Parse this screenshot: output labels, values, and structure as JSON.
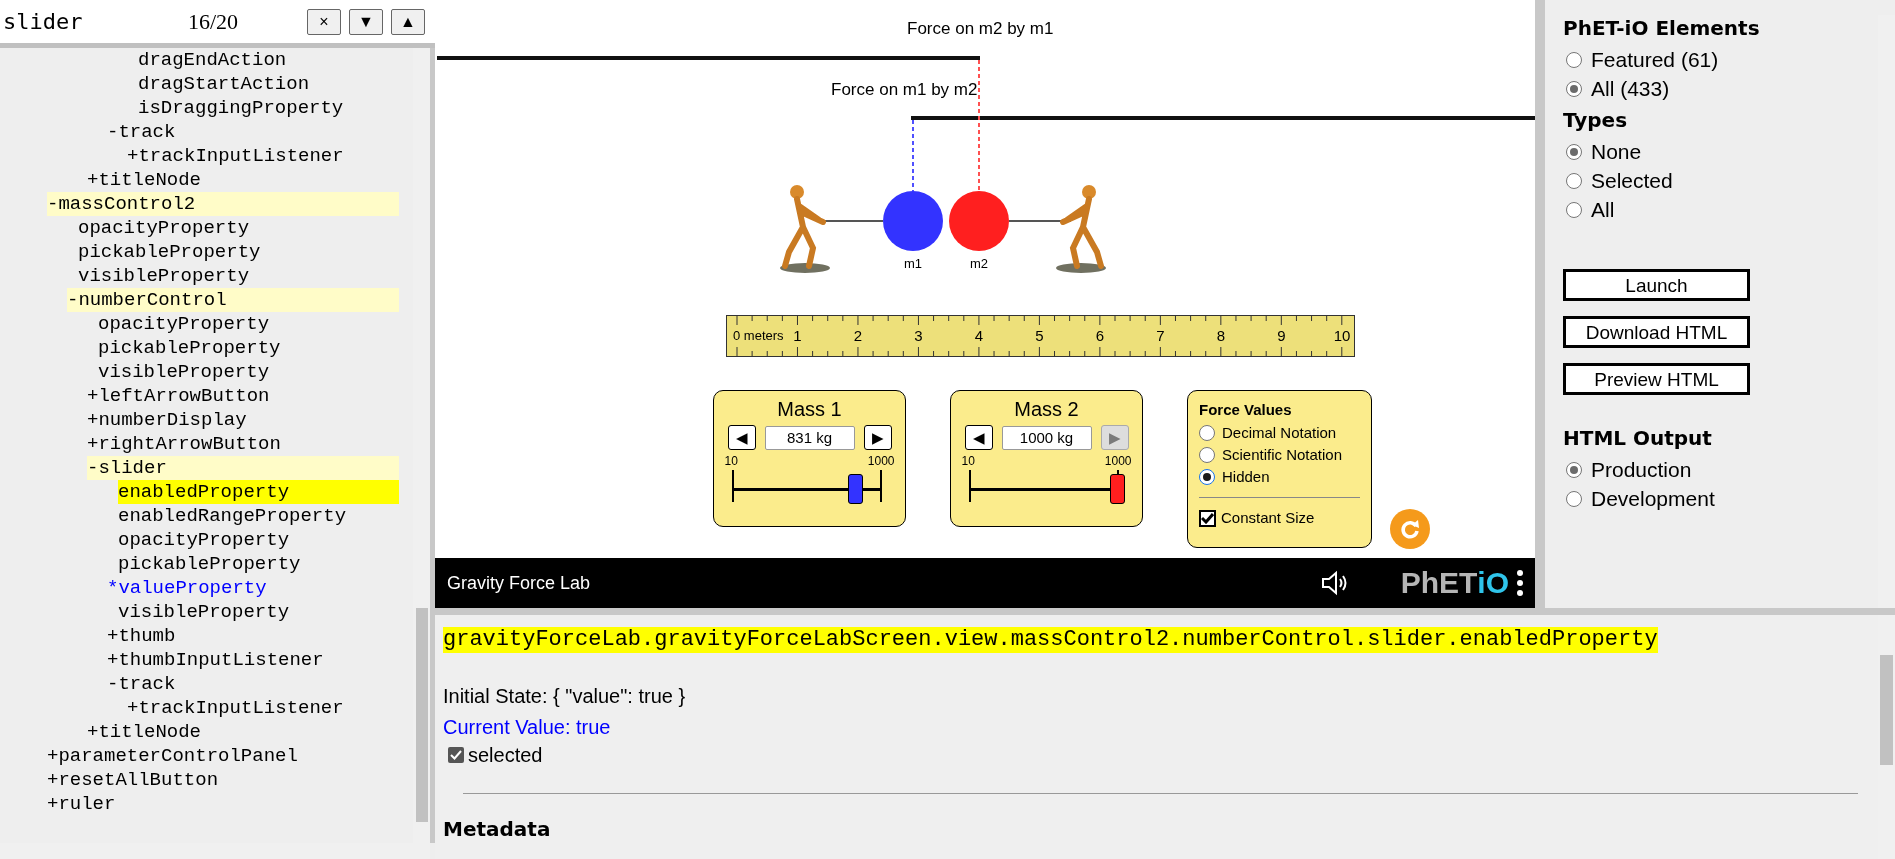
{
  "search": {
    "value": "slider",
    "count": "16/20",
    "buttons": [
      "×",
      "▼",
      "▲"
    ]
  },
  "tree": [
    {
      "children": [
        {
          "children": [
            {
              "children": [
                {
                  "children": [
                    {
                      "label": "dragEndAction",
                      "kind": "plain",
                      "on_path": false,
                      "selected": false,
                      "modified": false
                    },
                    {
                      "label": "dragStartAction",
                      "kind": "plain",
                      "on_path": false,
                      "selected": false,
                      "modified": false
                    },
                    {
                      "label": "isDraggingProperty",
                      "kind": "plain",
                      "on_path": false,
                      "selected": false,
                      "modified": false
                    }
                  ]
                },
                {
                  "label": "-track",
                  "kind": "marked",
                  "on_path": false,
                  "selected": false,
                  "modified": false,
                  "children": [
                    {
                      "label": "+trackInputListener",
                      "kind": "marked",
                      "on_path": false,
                      "selected": false,
                      "modified": false
                    }
                  ]
                }
              ]
            },
            {
              "label": "+titleNode",
              "kind": "marked",
              "on_path": false,
              "selected": false,
              "modified": false
            }
          ]
        }
      ]
    },
    {
      "label": "-massControl2",
      "kind": "marked",
      "on_path": true,
      "selected": false,
      "modified": false,
      "children": [
        {
          "label": "opacityProperty",
          "kind": "plain",
          "on_path": false,
          "selected": false,
          "modified": false
        },
        {
          "label": "pickableProperty",
          "kind": "plain",
          "on_path": false,
          "selected": false,
          "modified": false
        },
        {
          "label": "visibleProperty",
          "kind": "plain",
          "on_path": false,
          "selected": false,
          "modified": false
        },
        {
          "label": "-numberControl",
          "kind": "marked",
          "on_path": true,
          "selected": false,
          "modified": false,
          "children": [
            {
              "label": "opacityProperty",
              "kind": "plain",
              "on_path": false,
              "selected": false,
              "modified": false
            },
            {
              "label": "pickableProperty",
              "kind": "plain",
              "on_path": false,
              "selected": false,
              "modified": false
            },
            {
              "label": "visibleProperty",
              "kind": "plain",
              "on_path": false,
              "selected": false,
              "modified": false
            },
            {
              "label": "+leftArrowButton",
              "kind": "marked",
              "on_path": false,
              "selected": false,
              "modified": false
            },
            {
              "label": "+numberDisplay",
              "kind": "marked",
              "on_path": false,
              "selected": false,
              "modified": false
            },
            {
              "label": "+rightArrowButton",
              "kind": "marked",
              "on_path": false,
              "selected": false,
              "modified": false
            },
            {
              "label": "-slider",
              "kind": "marked",
              "on_path": true,
              "selected": false,
              "modified": false,
              "children": [
                {
                  "label": "enabledProperty",
                  "kind": "plain",
                  "on_path": false,
                  "selected": true,
                  "modified": false
                },
                {
                  "label": "enabledRangeProperty",
                  "kind": "plain",
                  "on_path": false,
                  "selected": false,
                  "modified": false
                },
                {
                  "label": "opacityProperty",
                  "kind": "plain",
                  "on_path": false,
                  "selected": false,
                  "modified": false
                },
                {
                  "label": "pickableProperty",
                  "kind": "plain",
                  "on_path": false,
                  "selected": false,
                  "modified": false
                },
                {
                  "label": "*valueProperty",
                  "kind": "marked",
                  "on_path": false,
                  "selected": false,
                  "modified": true
                },
                {
                  "label": "visibleProperty",
                  "kind": "plain",
                  "on_path": false,
                  "selected": false,
                  "modified": false
                },
                {
                  "label": "+thumb",
                  "kind": "marked",
                  "on_path": false,
                  "selected": false,
                  "modified": false
                },
                {
                  "label": "+thumbInputListener",
                  "kind": "marked",
                  "on_path": false,
                  "selected": false,
                  "modified": false
                },
                {
                  "label": "-track",
                  "kind": "marked",
                  "on_path": false,
                  "selected": false,
                  "modified": false,
                  "children": [
                    {
                      "label": "+trackInputListener",
                      "kind": "marked",
                      "on_path": false,
                      "selected": false,
                      "modified": false
                    }
                  ]
                }
              ]
            },
            {
              "label": "+titleNode",
              "kind": "marked",
              "on_path": false,
              "selected": false,
              "modified": false
            }
          ]
        }
      ]
    },
    {
      "label": "+parameterControlPanel",
      "kind": "marked",
      "on_path": false,
      "selected": false,
      "modified": false
    },
    {
      "label": "+resetAllButton",
      "kind": "marked",
      "on_path": false,
      "selected": false,
      "modified": false
    },
    {
      "label": "+ruler",
      "kind": "marked",
      "on_path": false,
      "selected": false,
      "modified": false
    }
  ],
  "sim": {
    "force_labels": [
      "Force on m2 by m1",
      "Force on m1 by m2"
    ],
    "masses": [
      {
        "label": "m1",
        "color": "#3333ff"
      },
      {
        "label": "m2",
        "color": "#ff1f1f"
      }
    ],
    "ruler": {
      "labels": [
        "0 meters",
        "1",
        "2",
        "3",
        "4",
        "5",
        "6",
        "7",
        "8",
        "9",
        "10"
      ]
    },
    "mass_controls": [
      {
        "title": "Mass 1",
        "value": "831 kg",
        "left_arrow": "◀",
        "right_arrow": "▶",
        "left_disabled": false,
        "right_disabled": false,
        "min": "10",
        "max": "1000",
        "level": 0.83,
        "color": "#3333ff"
      },
      {
        "title": "Mass 2",
        "value": "1000 kg",
        "left_arrow": "◀",
        "right_arrow": "▶",
        "left_disabled": false,
        "right_disabled": true,
        "min": "10",
        "max": "1000",
        "level": 1,
        "color": "#ff1f1f"
      }
    ],
    "force_values": {
      "title": "Force Values",
      "options": [
        {
          "label": "Decimal Notation",
          "selected": false
        },
        {
          "label": "Scientific Notation",
          "selected": false
        },
        {
          "label": "Hidden",
          "selected": true
        }
      ],
      "constant_size": {
        "label": "Constant Size",
        "checked": true
      }
    },
    "navbar": {
      "title": "Gravity Force Lab",
      "logo_main": "PhET",
      "logo_accent": "iO"
    }
  },
  "right_panel": {
    "elements": {
      "heading": "PhET-iO Elements",
      "options": [
        {
          "label": "Featured (61)",
          "selected": false
        },
        {
          "label": "All (433)",
          "selected": true
        }
      ]
    },
    "types": {
      "heading": "Types",
      "options": [
        {
          "label": "None",
          "selected": true
        },
        {
          "label": "Selected",
          "selected": false
        },
        {
          "label": "All",
          "selected": false
        }
      ]
    },
    "buttons": [
      "Launch",
      "Download HTML",
      "Preview HTML"
    ],
    "html_output": {
      "heading": "HTML Output",
      "options": [
        {
          "label": "Production",
          "selected": true
        },
        {
          "label": "Development",
          "selected": false
        }
      ]
    }
  },
  "details": {
    "phetio_id": "gravityForceLab.gravityForceLabScreen.view.massControl2.numberControl.slider.enabledProperty",
    "initial_state": "Initial State: { \"value\": true }",
    "current_value": "Current Value: true",
    "selected_checkbox": {
      "label": "selected",
      "checked": true
    },
    "metadata_heading": "Metadata"
  }
}
